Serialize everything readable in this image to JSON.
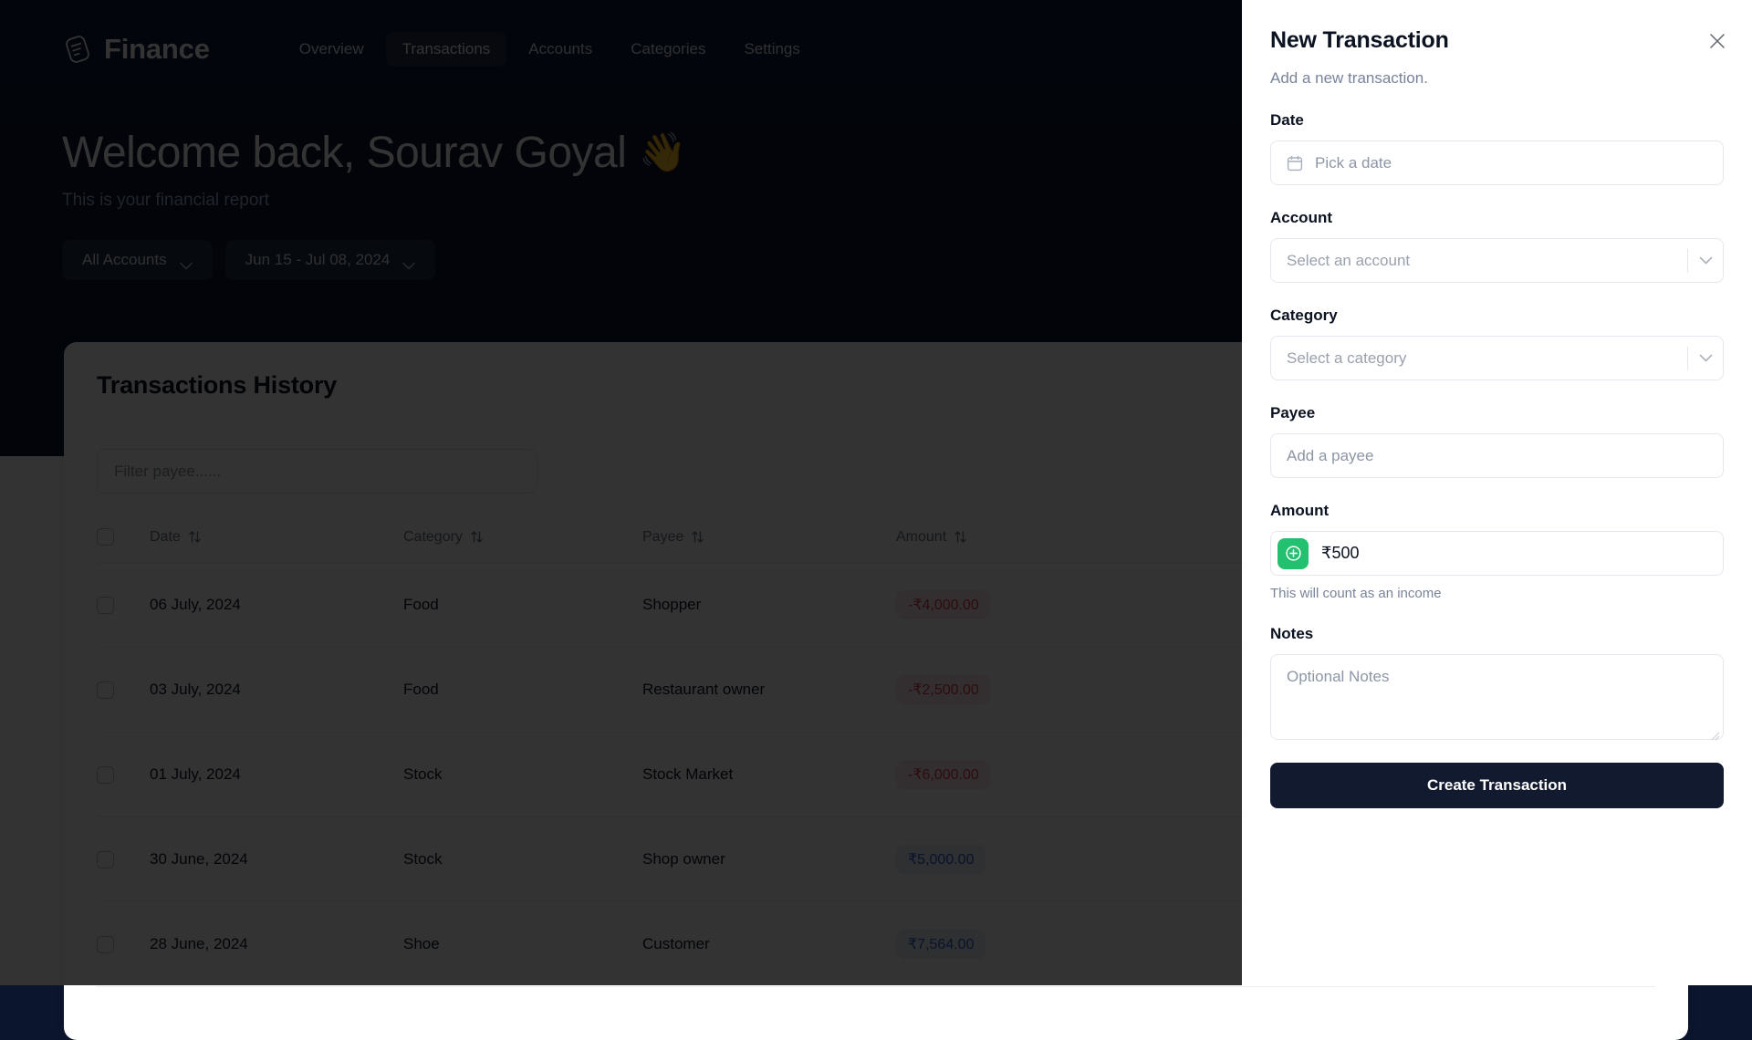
{
  "header": {
    "brand": "Finance",
    "nav": [
      {
        "label": "Overview",
        "active": false
      },
      {
        "label": "Transactions",
        "active": true
      },
      {
        "label": "Accounts",
        "active": false
      },
      {
        "label": "Categories",
        "active": false
      },
      {
        "label": "Settings",
        "active": false
      }
    ]
  },
  "hero": {
    "welcome": "Welcome back, Sourav Goyal",
    "wave": "👋",
    "subtitle": "This is your financial report",
    "account_filter": "All Accounts",
    "date_filter": "Jun 15 - Jul 08, 2024"
  },
  "card": {
    "title": "Transactions History",
    "filter_placeholder": "Filter payee......",
    "columns": [
      "Date",
      "Category",
      "Payee",
      "Amount"
    ],
    "rows": [
      {
        "date": "06 July, 2024",
        "category": "Food",
        "payee": "Shopper",
        "amount": "-₹4,000.00",
        "sign": "neg"
      },
      {
        "date": "03 July, 2024",
        "category": "Food",
        "payee": "Restaurant owner",
        "amount": "-₹2,500.00",
        "sign": "neg"
      },
      {
        "date": "01 July, 2024",
        "category": "Stock",
        "payee": "Stock Market",
        "amount": "-₹6,000.00",
        "sign": "neg"
      },
      {
        "date": "30 June, 2024",
        "category": "Stock",
        "payee": "Shop owner",
        "amount": "₹5,000.00",
        "sign": "pos"
      },
      {
        "date": "28 June, 2024",
        "category": "Shoe",
        "payee": "Customer",
        "amount": "₹7,564.00",
        "sign": "pos"
      }
    ]
  },
  "sheet": {
    "title": "New Transaction",
    "description": "Add a new transaction.",
    "date": {
      "label": "Date",
      "placeholder": "Pick a date"
    },
    "account": {
      "label": "Account",
      "placeholder": "Select an account"
    },
    "category": {
      "label": "Category",
      "placeholder": "Select a category"
    },
    "payee": {
      "label": "Payee",
      "placeholder": "Add a payee"
    },
    "amount": {
      "label": "Amount",
      "value": "₹500",
      "hint": "This will count as an income",
      "toggle_color": "#22c06f"
    },
    "notes": {
      "label": "Notes",
      "placeholder": "Optional Notes"
    },
    "submit": "Create Transaction"
  },
  "colors": {
    "hero_bg": "#0b1a38",
    "sheet_button": "#111a2e",
    "income_green": "#22c06f",
    "negative": "#e03b4a",
    "positive": "#2f5fd0"
  }
}
